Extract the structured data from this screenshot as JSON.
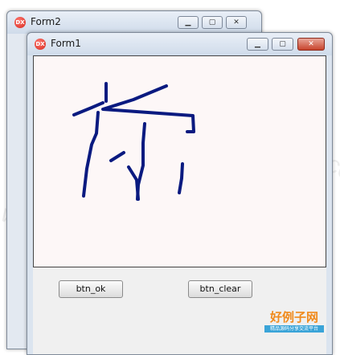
{
  "watermark": "www.haolizi.com",
  "back_window": {
    "title": "Form2",
    "icon_label": "DX",
    "min_glyph": "▁",
    "max_glyph": "▢",
    "close_glyph": "✕"
  },
  "front_window": {
    "title": "Form1",
    "icon_label": "DX",
    "min_glyph": "▁",
    "max_glyph": "▢",
    "close_glyph": "✕",
    "buttons": {
      "ok_label": "btn_ok",
      "clear_label": "btn_clear"
    },
    "stroke_color": "#0a1a80"
  },
  "logo": {
    "main": "好例子网",
    "sub": "精品源码分享交流平台"
  }
}
